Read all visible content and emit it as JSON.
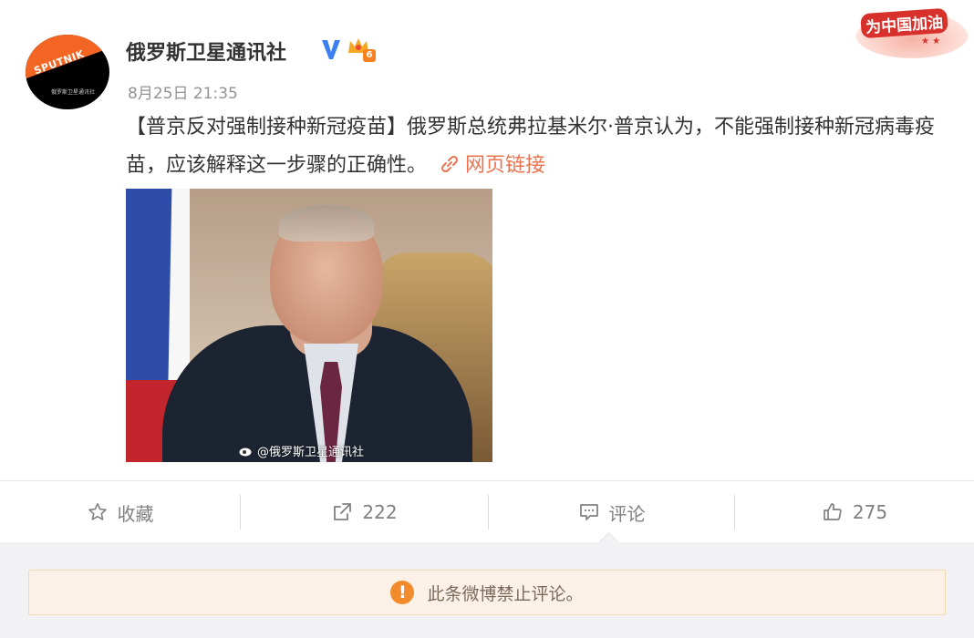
{
  "post": {
    "author": "俄罗斯卫星通讯社",
    "avatar_brand": "SPUTNIK",
    "avatar_caption": "俄罗斯卫星通讯社",
    "level": "6",
    "timestamp": "8月25日 21:35",
    "text": "【普京反对强制接种新冠疫苗】俄罗斯总统弗拉基米尔·普京认为，不能强制接种新冠病毒疫苗，应该解释这一步骤的正确性。",
    "link_label": "网页链接",
    "image_watermark": "@俄罗斯卫星通讯社",
    "sticker_text": "为中国加油"
  },
  "actions": {
    "favorite_label": "收藏",
    "repost_count": "222",
    "comment_label": "评论",
    "like_count": "275"
  },
  "comments": {
    "notice": "此条微博禁止评论。"
  },
  "colors": {
    "link": "#eb7350",
    "verified": "#3b7ff0",
    "warning": "#f18b2b",
    "brand_orange": "#f26522"
  }
}
